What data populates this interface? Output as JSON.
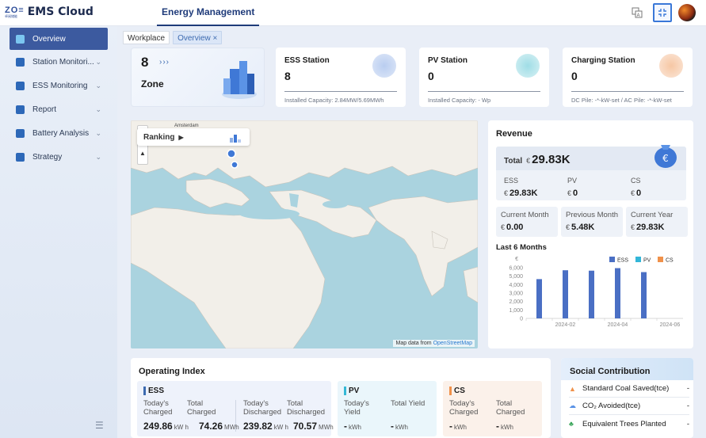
{
  "app": {
    "logo_mark": "ZO≡",
    "logo_sub": "卓阅储能",
    "title": "EMS Cloud",
    "nav_tab": "Energy Management"
  },
  "toolbar": {
    "translate_icon": "translate-icon",
    "fullscreen_icon": "fullscreen-icon",
    "avatar": "user-avatar"
  },
  "sidebar": {
    "items": [
      {
        "label": "Overview",
        "icon": "overview-icon",
        "active": true
      },
      {
        "label": "Station Monitori...",
        "icon": "station-monitoring-icon",
        "chevron": "⌄"
      },
      {
        "label": "ESS Monitoring",
        "icon": "ess-monitoring-icon",
        "chevron": "⌄"
      },
      {
        "label": "Report",
        "icon": "report-icon",
        "chevron": "⌄"
      },
      {
        "label": "Battery Analysis",
        "icon": "battery-analysis-icon",
        "chevron": "⌄"
      },
      {
        "label": "Strategy",
        "icon": "strategy-icon",
        "chevron": "⌄"
      }
    ],
    "collapse_icon": "collapse-menu-icon"
  },
  "tabs": [
    {
      "label": "Workplace"
    },
    {
      "label": "Overview ×",
      "active": true
    }
  ],
  "zone": {
    "count": "8",
    "arrows": "›››",
    "label": "Zone"
  },
  "stats": {
    "ess": {
      "title": "ESS Station",
      "value": "8",
      "sub": "Installed Capacity: 2.84MW/5.69MWh"
    },
    "pv": {
      "title": "PV Station",
      "value": "0",
      "sub": "Installed Capacity: - Wp"
    },
    "charging": {
      "title": "Charging Station",
      "value": "0",
      "sub": "DC Pile: -*-kW-set / AC Pile: -*-kW-set"
    }
  },
  "map": {
    "ranking_label": "Ranking",
    "zoom_in": "+",
    "zoom_out": "−",
    "place_label": "Amsterdam",
    "attribution_prefix": "Map data from",
    "attribution_link": "OpenStreetMap"
  },
  "revenue": {
    "title": "Revenue",
    "total_label": "Total",
    "currency": "€",
    "total_value": "29.83K",
    "ess_label": "ESS",
    "ess_value": "29.83K",
    "pv_label": "PV",
    "pv_value": "0",
    "cs_label": "CS",
    "cs_value": "0",
    "current_month_label": "Current Month",
    "current_month_value": "0.00",
    "previous_month_label": "Previous Month",
    "previous_month_value": "5.48K",
    "current_year_label": "Current Year",
    "current_year_value": "29.83K",
    "last6_label": "Last 6 Months"
  },
  "chart_data": {
    "type": "bar",
    "title": "",
    "xlabel": "",
    "ylabel": "€",
    "ylim": [
      0,
      6000
    ],
    "y_ticks": [
      "0",
      "1,000",
      "2,000",
      "3,000",
      "4,000",
      "5,000",
      "6,000"
    ],
    "x_tick_labels": [
      "2024-02",
      "2024-04",
      "2024-06"
    ],
    "categories": [
      "2024-01",
      "2024-02",
      "2024-03",
      "2024-04",
      "2024-05",
      "2024-06"
    ],
    "series": [
      {
        "name": "ESS",
        "color": "#4a6fc4",
        "values": [
          4650,
          5700,
          5650,
          5950,
          5480,
          0
        ]
      },
      {
        "name": "PV",
        "color": "#33b6d8",
        "values": [
          0,
          0,
          0,
          0,
          0,
          0
        ]
      },
      {
        "name": "CS",
        "color": "#f0914a",
        "values": [
          0,
          0,
          0,
          0,
          0,
          0
        ]
      }
    ],
    "legend_position": "top-right"
  },
  "operating": {
    "title": "Operating Index",
    "ess": {
      "label": "ESS",
      "today_charged_label": "Today's Charged",
      "total_charged_label": "Total Charged",
      "today_discharged_label": "Today's Discharged",
      "total_discharged_label": "Total Discharged",
      "today_charged": "249.86",
      "today_charged_unit": "kW h",
      "total_charged": "74.26",
      "total_charged_unit": "MWh",
      "today_discharged": "239.82",
      "today_discharged_unit": "kW h",
      "total_discharged": "70.57",
      "total_discharged_unit": "MWh"
    },
    "pv": {
      "label": "PV",
      "today_yield_label": "Today's Yield",
      "total_yield_label": "Total Yield",
      "today_yield": "-",
      "total_yield": "-",
      "unit": "kWh"
    },
    "cs": {
      "label": "CS",
      "today_charged_label": "Today's Charged",
      "total_charged_label": "Total Charged",
      "today_charged": "-",
      "total_charged": "-",
      "unit": "kWh"
    }
  },
  "social": {
    "title": "Social Contribution",
    "rows": [
      {
        "label": "Standard Coal Saved(tce)",
        "value": "-",
        "icon": "coal-icon"
      },
      {
        "label": "CO₂ Avoided(tce)",
        "value": "-",
        "icon": "cloud-icon"
      },
      {
        "label": "Equivalent Trees Planted",
        "value": "-",
        "icon": "tree-icon"
      }
    ]
  }
}
